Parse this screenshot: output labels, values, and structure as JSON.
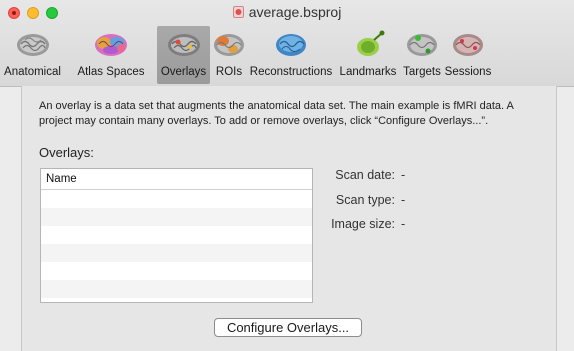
{
  "window": {
    "title": "average.bsproj"
  },
  "toolbar": {
    "items": [
      {
        "label": "Anatomical",
        "icon": "brain-gray-icon",
        "selected": false
      },
      {
        "label": "Atlas Spaces",
        "icon": "brain-atlas-icon",
        "selected": false
      },
      {
        "label": "Overlays",
        "icon": "brain-overlay-icon",
        "selected": true
      },
      {
        "label": "ROIs",
        "icon": "brain-roi-icon",
        "selected": false
      },
      {
        "label": "Reconstructions",
        "icon": "brain-reconstruction-icon",
        "selected": false
      },
      {
        "label": "Landmarks",
        "icon": "brain-landmark-icon",
        "selected": false
      },
      {
        "label": "Targets",
        "icon": "brain-target-icon",
        "selected": false
      },
      {
        "label": "Sessions",
        "icon": "brain-session-icon",
        "selected": false
      }
    ]
  },
  "panel": {
    "description": "An overlay is a data set that augments the anatomical data set. The main example is fMRI data. A project may contain many overlays. To add or remove overlays, click “Configure Overlays...”.",
    "overlays_heading": "Overlays:",
    "table": {
      "columns": [
        "Name"
      ],
      "rows": []
    },
    "info": {
      "scan_date_label": "Scan date:",
      "scan_date_value": "-",
      "scan_type_label": "Scan type:",
      "scan_type_value": "-",
      "image_size_label": "Image size:",
      "image_size_value": "-"
    },
    "configure_button": "Configure Overlays..."
  },
  "colors": {
    "selected_tab": "#9f9f9f",
    "close": "#fe5f57",
    "minimize": "#febc2e",
    "maximize": "#28c840"
  }
}
